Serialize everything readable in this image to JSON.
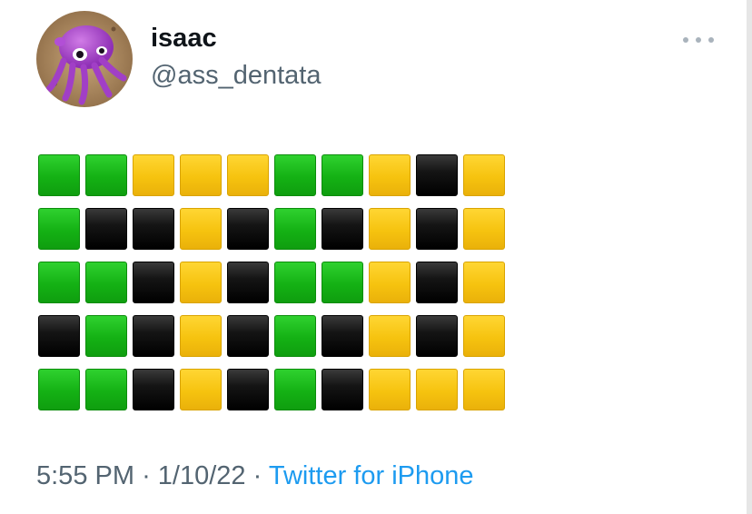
{
  "author": {
    "display_name": "isaac",
    "handle": "@ass_dentata",
    "avatar_icon": "purple-octopus-avatar"
  },
  "more_icon": "more-horizontal-icon",
  "wordle_grid": [
    [
      "green",
      "green",
      "yellow",
      "yellow",
      "yellow",
      "green",
      "green",
      "yellow",
      "black",
      "yellow"
    ],
    [
      "green",
      "black",
      "black",
      "yellow",
      "black",
      "green",
      "black",
      "yellow",
      "black",
      "yellow"
    ],
    [
      "green",
      "green",
      "black",
      "yellow",
      "black",
      "green",
      "green",
      "yellow",
      "black",
      "yellow"
    ],
    [
      "black",
      "green",
      "black",
      "yellow",
      "black",
      "green",
      "black",
      "yellow",
      "black",
      "yellow"
    ],
    [
      "green",
      "green",
      "black",
      "yellow",
      "black",
      "green",
      "black",
      "yellow",
      "yellow",
      "yellow"
    ]
  ],
  "colors": {
    "green": "#14b114",
    "yellow": "#f6c30f",
    "black": "#111111",
    "link": "#1d9bf0",
    "secondary_text": "#536471"
  },
  "tweet_meta": {
    "time": "5:55 PM",
    "separator": "·",
    "date": "1/10/22",
    "source": "Twitter for iPhone"
  }
}
